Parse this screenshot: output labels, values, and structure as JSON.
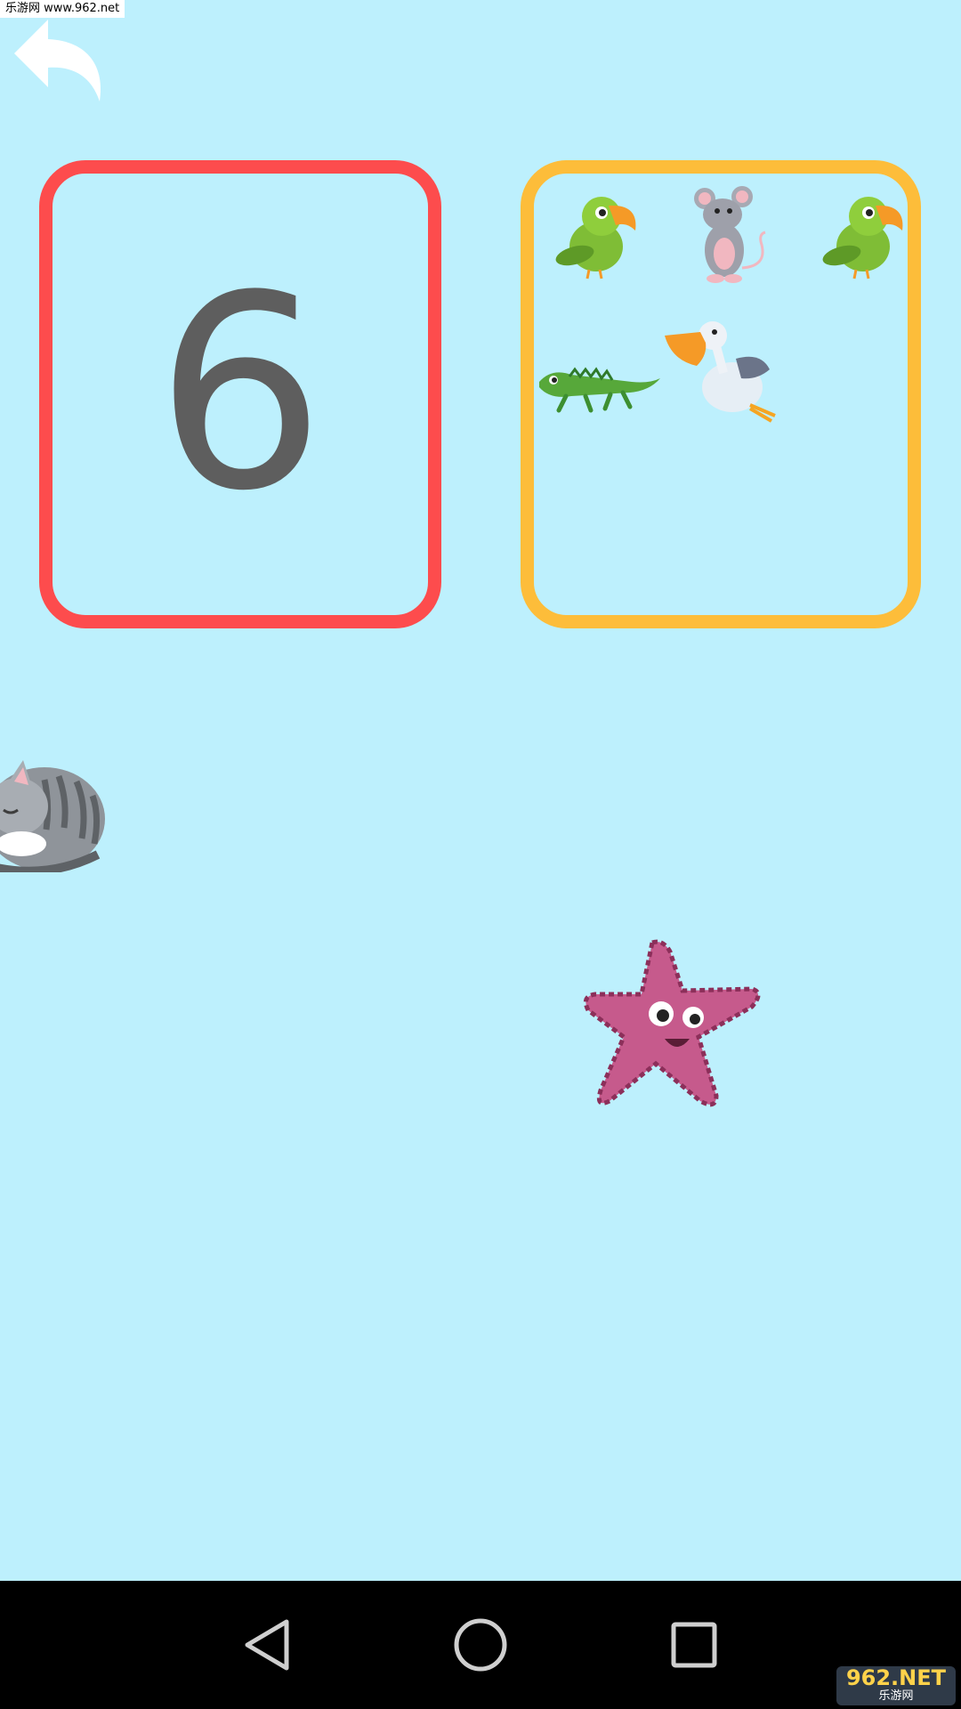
{
  "watermark": {
    "top_text": "乐游网 www.962.net",
    "logo_big": "962.NET",
    "logo_small": "乐游网"
  },
  "game": {
    "target_number": "6",
    "grouped_animals": [
      "parrot",
      "mouse",
      "parrot",
      "lizard",
      "pelican"
    ],
    "draggable_animals": [
      "cat",
      "starfish"
    ]
  },
  "colors": {
    "background": "#bdf0fd",
    "number_card_border": "#fd4c4d",
    "animal_card_border": "#fdbd3a",
    "digit": "#5e5e5e"
  },
  "icons": {
    "back": "back-arrow-icon",
    "nav_back": "triangle-back-icon",
    "nav_home": "circle-home-icon",
    "nav_recents": "square-recents-icon"
  }
}
